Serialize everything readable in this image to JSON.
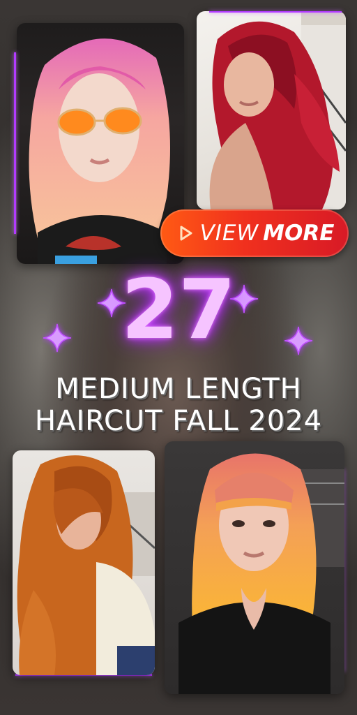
{
  "promo": {
    "cta": {
      "view_label": "VIEW",
      "more_label": "MORE"
    },
    "count": "27",
    "headline": {
      "line1": "MEDIUM LENGTH",
      "line2": "HAIRCUT FALL 2024"
    }
  },
  "colors": {
    "neon_purple": "#b23bff",
    "cta_start": "#ff5a14",
    "cta_end": "#d81a26"
  },
  "icons": {
    "play": "play-icon",
    "sparkle": "sparkle-icon"
  }
}
